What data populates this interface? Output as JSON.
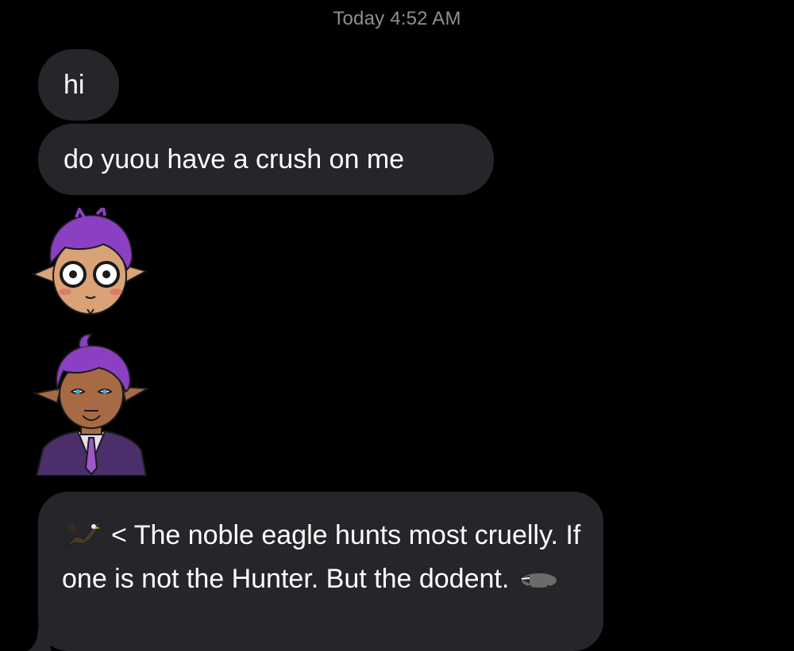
{
  "conversation": {
    "timestamp": "Today 4:52 AM",
    "messages": [
      {
        "text": "hi"
      },
      {
        "text": "do yuou have a crush on me"
      },
      {
        "text_before_emoji": "< The noble eagle hunts most cruelly. If one is not the Hunter. But the dodent.",
        "lead_emoji": "eagle-icon",
        "trail_emoji": "badger-icon"
      }
    ],
    "stickers": [
      {
        "name": "surprised-elf-sticker"
      },
      {
        "name": "suited-elf-sticker"
      }
    ]
  },
  "colors": {
    "background": "#000000",
    "bubble": "#26252a",
    "timestamp": "#8e8e93",
    "hair": "#8b3fc2",
    "skin_light": "#d9a277",
    "skin_dark": "#a86a44",
    "suit": "#4a2f6b"
  }
}
